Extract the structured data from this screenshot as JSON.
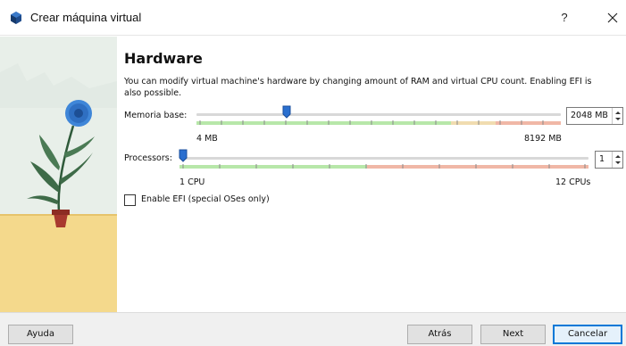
{
  "window": {
    "title": "Crear máquina virtual",
    "help_label": "?",
    "close_icon": "close-icon",
    "app_icon": "virtualbox-icon"
  },
  "page": {
    "heading": "Hardware",
    "description": "You can modify virtual machine's hardware by changing amount of RAM and virtual CPU count. Enabling EFI is also possible."
  },
  "memory": {
    "label": "Memoria base:",
    "min_label": "4 MB",
    "max_label": "8192 MB",
    "value": "2048 MB",
    "value_mb": 2048,
    "min_mb": 4,
    "max_mb": 8192
  },
  "processors": {
    "label": "Processors:",
    "min_label": "1 CPU",
    "max_label": "12 CPUs",
    "value": "1",
    "value_num": 1,
    "min": 1,
    "max": 12
  },
  "efi": {
    "label": "Enable EFI (special OSes only)",
    "checked": false
  },
  "buttons": {
    "help": "Ayuda",
    "back": "Atrás",
    "next": "Next",
    "cancel": "Cancelar"
  },
  "colors": {
    "green": "#b7e7a9",
    "red": "#f0b7a6",
    "handle": "#2a6fcf"
  }
}
